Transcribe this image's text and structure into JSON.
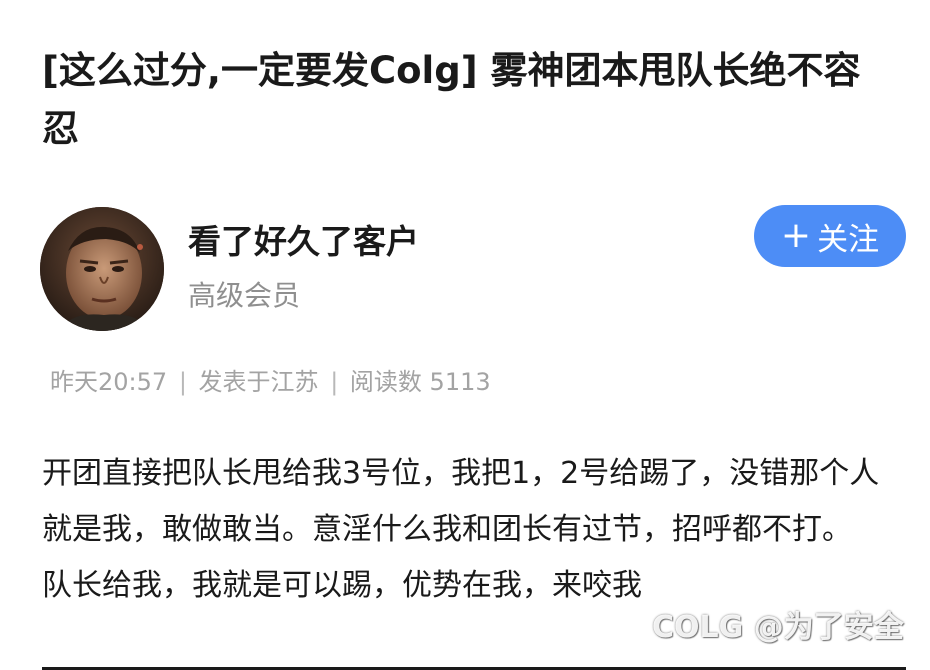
{
  "post": {
    "title": "[这么过分,一定要发Colg] 雾神团本甩队长绝不容忍"
  },
  "author": {
    "name": "看了好久了客户",
    "rank": "高级会员",
    "avatar_icon": "avatar-man-photo"
  },
  "follow": {
    "plus_symbol": "+",
    "label": "关注",
    "color": "#4d8df6"
  },
  "meta": {
    "time": "昨天20:57",
    "location": "发表于江苏",
    "reads": "阅读数 5113",
    "separator": "|"
  },
  "content": {
    "paragraph_1": "开团直接把队长甩给我3号位，我把1，2号给踢了，没错那个人就是我，敢做敢当。意淫什么我和团长有过节，招呼都不打。",
    "paragraph_2": "队长给我，我就是可以踢，优势在我，来咬我"
  },
  "watermark": {
    "text": "COLG @为了安全"
  }
}
